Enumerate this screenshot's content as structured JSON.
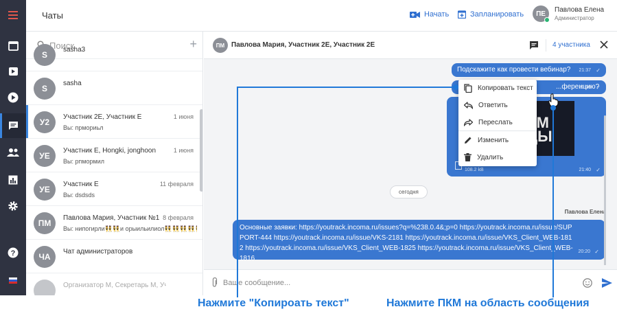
{
  "app": {
    "title": "Чаты",
    "actions": {
      "start": "Начать",
      "schedule": "Запланировать"
    },
    "user": {
      "initials": "ПЕ",
      "name": "Павлова Елена",
      "role": "Администратор"
    }
  },
  "rail": {
    "items": [
      {
        "icon": "menu-icon"
      },
      {
        "icon": "calendar-icon"
      },
      {
        "icon": "video-icon"
      },
      {
        "icon": "play-icon"
      },
      {
        "icon": "chat-icon",
        "active": true
      },
      {
        "icon": "contacts-icon"
      },
      {
        "icon": "stats-icon"
      },
      {
        "icon": "gear-icon"
      },
      {
        "icon": "help-icon"
      },
      {
        "icon": "flag-icon"
      }
    ]
  },
  "sidebar": {
    "search_placeholder": "Поиск",
    "chats": [
      {
        "initials": "S",
        "name": "sasha3",
        "date": "",
        "preview": ""
      },
      {
        "initials": "S",
        "name": "sasha",
        "date": "",
        "preview": ""
      },
      {
        "initials": "У2",
        "name": "Участник 2Е, Участник Е",
        "date": "1 июня",
        "preview": "Вы: прмориьл"
      },
      {
        "initials": "УЕ",
        "name": "Участник Е, Hongki, jonghoon",
        "date": "1 июня",
        "preview": "Вы: рпмормил"
      },
      {
        "initials": "УЕ",
        "name": "Участник Е",
        "date": "11 февраля",
        "preview": "Вы: dsdsds"
      },
      {
        "initials": "ПМ",
        "name": "Павлова Мария, Участник №1",
        "date": "8 февраля",
        "preview": "Вы: нипогирли👯👯и орыильилиол👯👯👯👯👯👯👯"
      },
      {
        "initials": "ЧА",
        "name": "Чат администраторов",
        "date": "",
        "preview": ""
      },
      {
        "initials": "",
        "name": "Организатор М, Секретарь М, Участник...",
        "date": "",
        "preview": ""
      }
    ]
  },
  "chat": {
    "initials": "ПМ",
    "name": "Павлова Мария, Участник 2Е, Участник 2Е",
    "members": "4 участника",
    "messages": {
      "m1": {
        "text": "Подскажите как провести вебинар?",
        "time": "21:37",
        "tick": "✓"
      },
      "m2": {
        "text": "...ференцию?",
        "time": "21:38",
        "tick": "✓"
      },
      "img": {
        "image_text": "ЕМ\nЦЫ",
        "size": "108.2 kB",
        "time": "21:40",
        "tick": "✓"
      },
      "day": "сегодня",
      "sender": "Павлова Елена",
      "long": {
        "text": "Основные заявки: https://youtrack.incoma.ru/issues?q=%238.0.4&;p=0 https://youtrack.incoma.ru/issue/SUPPORT-444 https://youtrack.incoma.ru/issue/VKS-2181 https://youtrack.incoma.ru/issue/VKS_Client_WEB-1812 https://youtrack.incoma.ru/issue/VKS_Client_WEB-1825 https://youtrack.incoma.ru/issue/VKS_Client_WEB-1816",
        "time": "20:20",
        "tick": "✓"
      }
    },
    "composer_placeholder": "Ваше сообщение..."
  },
  "context_menu": {
    "copy": "Копировать текст",
    "reply": "Ответить",
    "forward": "Переслать",
    "edit": "Изменить",
    "delete": "Удалить"
  },
  "captions": {
    "left": "Нажмите \"Копироать текст\"",
    "right": "Нажмите ПКМ на область сообщения"
  },
  "colors": {
    "accent": "#3a77d0",
    "rail": "#2f3341",
    "guide": "#1f78d8"
  }
}
